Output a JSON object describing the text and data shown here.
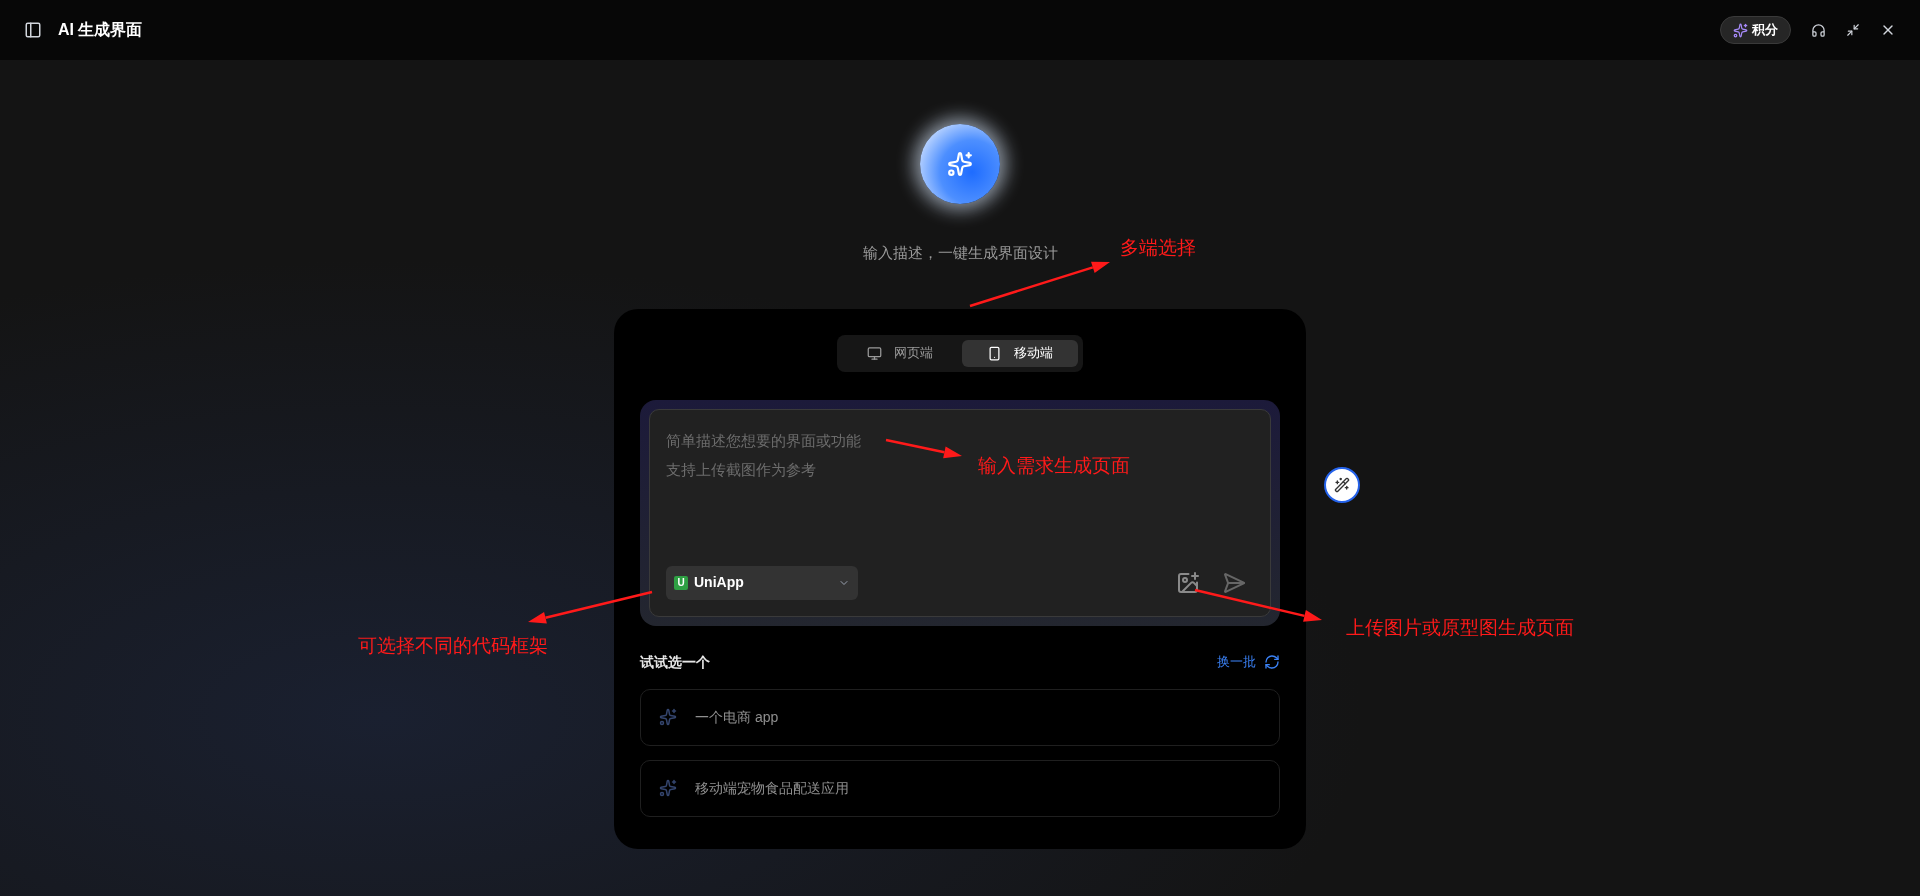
{
  "titlebar": {
    "title": "AI 生成界面",
    "points_label": "积分"
  },
  "hero": {
    "subtitle": "输入描述，一键生成界面设计"
  },
  "platform_tabs": [
    {
      "label": "网页端",
      "kind": "desktop",
      "selected": false
    },
    {
      "label": "移动端",
      "kind": "mobile",
      "selected": true
    }
  ],
  "prompt": {
    "placeholder_lines": [
      "简单描述您想要的界面或功能",
      "支持上传截图作为参考"
    ],
    "framework": "UniApp",
    "framework_badge": "U"
  },
  "suggestions": {
    "title": "试试选一个",
    "refresh": "换一批",
    "items": [
      "一个电商 app",
      "移动端宠物食品配送应用"
    ]
  },
  "annotations": [
    "多端选择",
    "输入需求生成页面",
    "可选择不同的代码框架",
    "上传图片或原型图生成页面"
  ]
}
